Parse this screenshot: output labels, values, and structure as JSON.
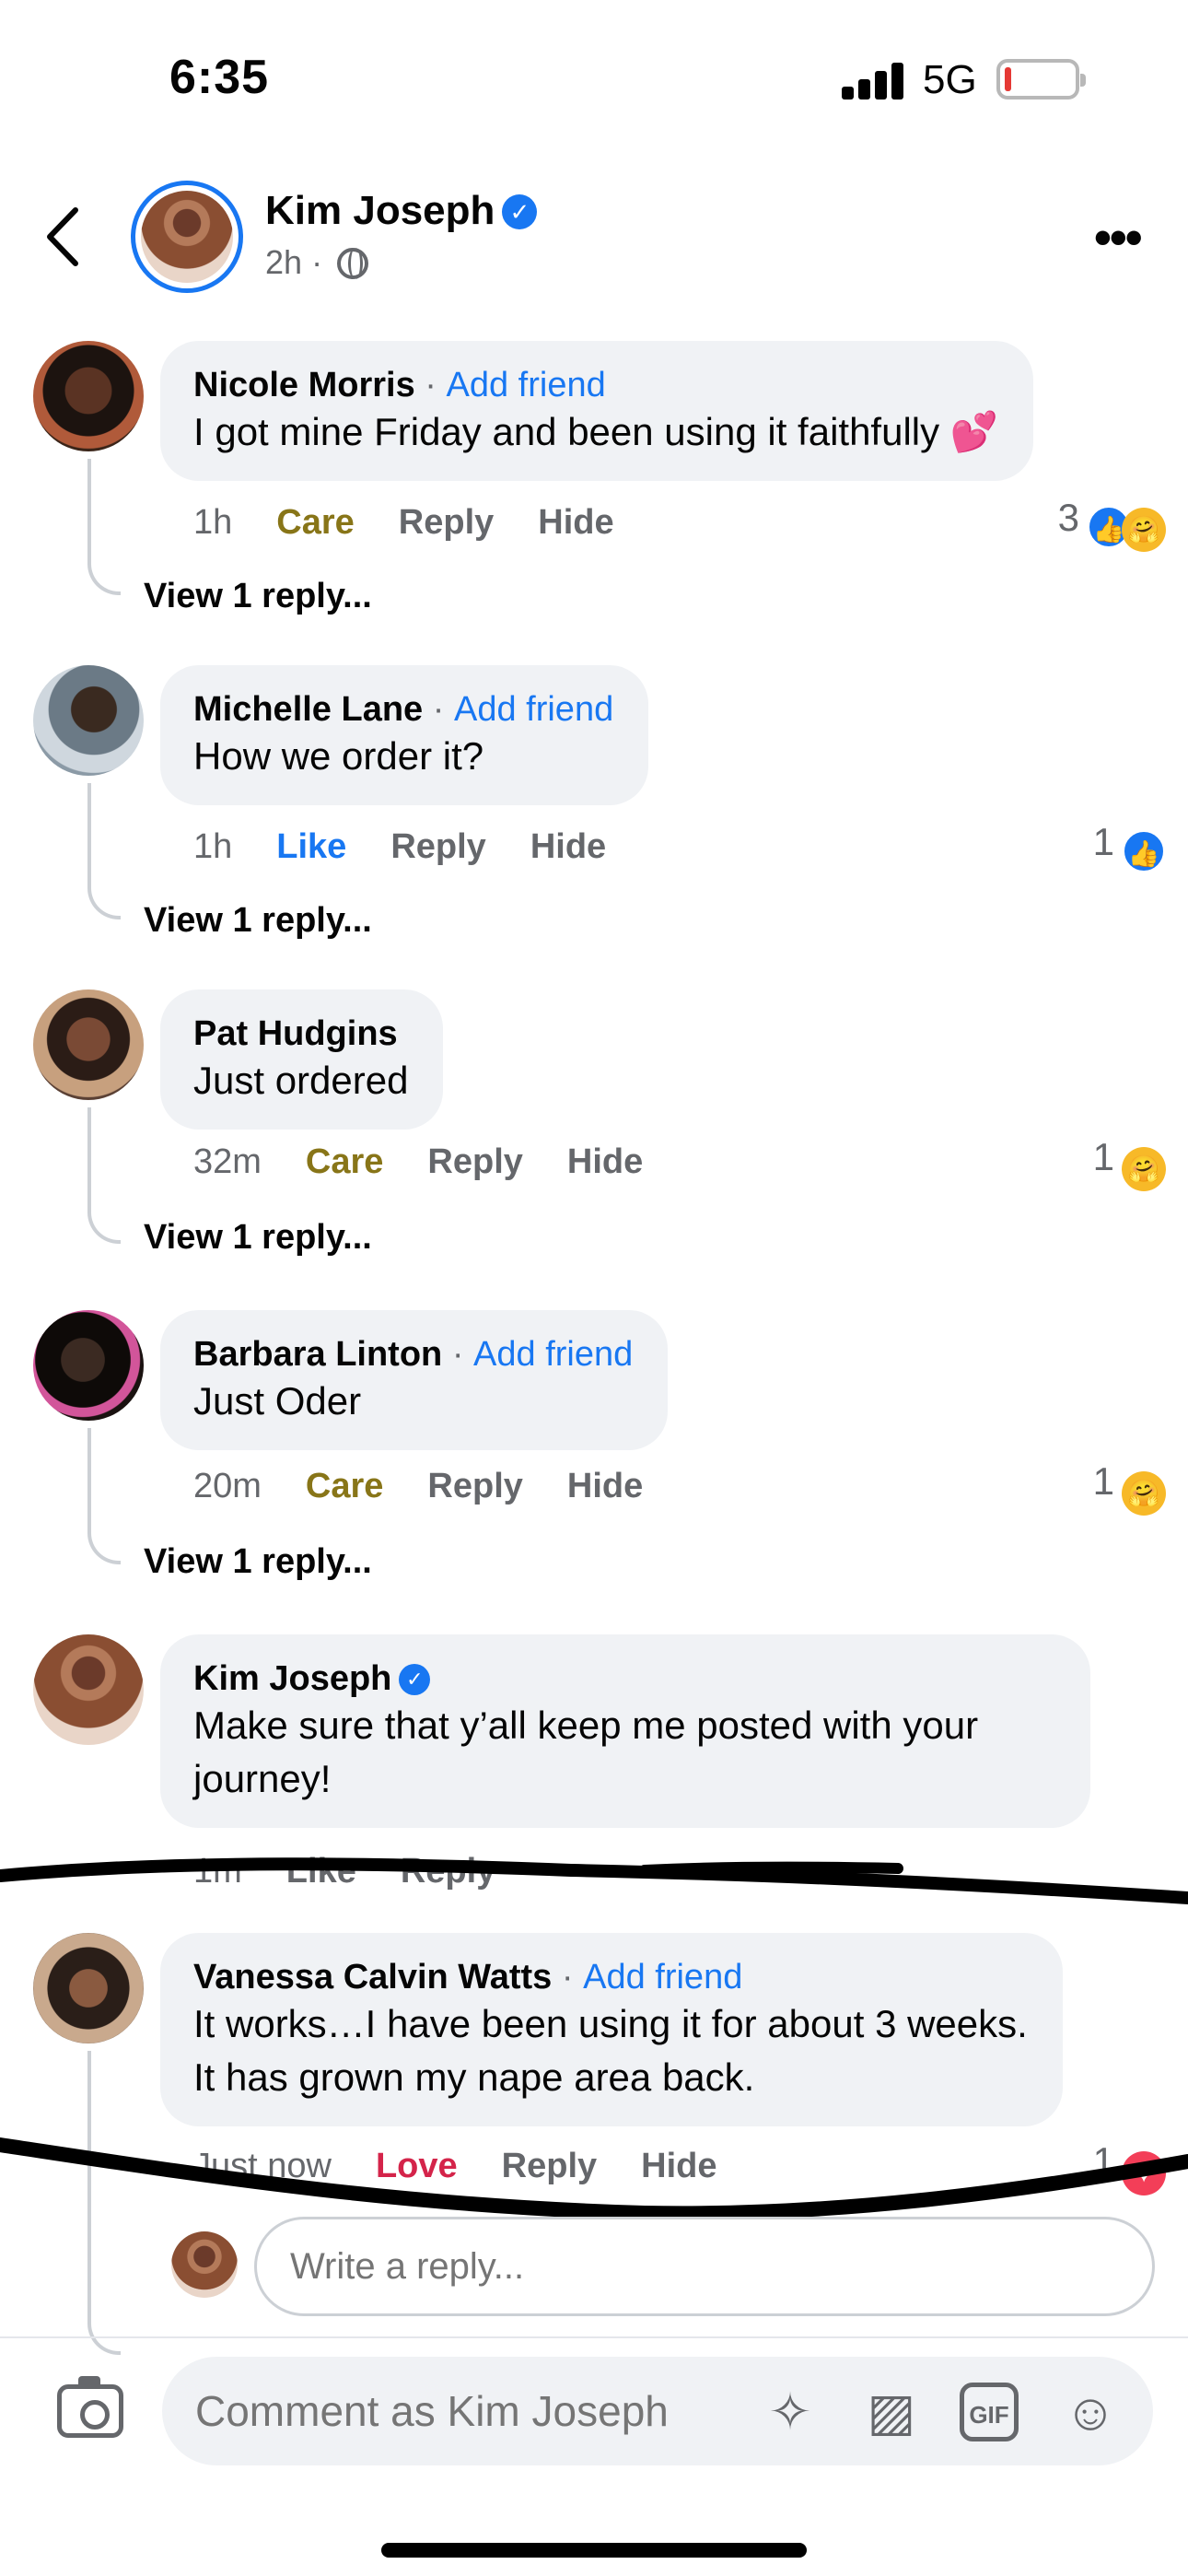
{
  "status_bar": {
    "time": "6:35",
    "network": "5G"
  },
  "post": {
    "author": "Kim Joseph",
    "time": "2h",
    "separator": "·"
  },
  "comments": [
    {
      "author": "Nicole Morris",
      "add_friend": "Add friend",
      "separator": "·",
      "text": "I got mine Friday and been using it faithfully 💕",
      "time": "1h",
      "reaction": "Care",
      "reply": "Reply",
      "hide": "Hide",
      "count": "3",
      "view_replies": "View 1 reply..."
    },
    {
      "author": "Michelle Lane",
      "add_friend": "Add friend",
      "separator": "·",
      "text": "How we order it?",
      "time": "1h",
      "reaction": "Like",
      "reply": "Reply",
      "hide": "Hide",
      "count": "1",
      "view_replies": "View 1 reply..."
    },
    {
      "author": "Pat Hudgins",
      "text": "Just ordered",
      "time": "32m",
      "reaction": "Care",
      "reply": "Reply",
      "hide": "Hide",
      "count": "1",
      "view_replies": "View 1 reply..."
    },
    {
      "author": "Barbara Linton",
      "add_friend": "Add friend",
      "separator": "·",
      "text": "Just Oder",
      "time": "20m",
      "reaction": "Care",
      "reply": "Reply",
      "hide": "Hide",
      "count": "1",
      "view_replies": "View 1 reply..."
    },
    {
      "author": "Kim Joseph",
      "text_line1": "Make sure that y’all keep me posted with your",
      "text_line2": "journey!",
      "time": "1m",
      "reaction": "Like",
      "reply": "Reply"
    },
    {
      "author": "Vanessa Calvin Watts",
      "add_friend": "Add friend",
      "separator": "·",
      "text_line1": "It works…I have been using it for about 3 weeks.",
      "text_line2": "It has grown my nape area back.",
      "time": "Just now",
      "reaction": "Love",
      "reply": "Reply",
      "hide": "Hide",
      "count": "1"
    }
  ],
  "reply_box": {
    "placeholder": "Write a reply..."
  },
  "composer": {
    "placeholder": "Comment as Kim Joseph"
  },
  "colors": {
    "link": "#1877f2",
    "care": "#887518",
    "love": "#d4244a",
    "bubble": "#f0f2f5",
    "muted": "#65676b"
  }
}
